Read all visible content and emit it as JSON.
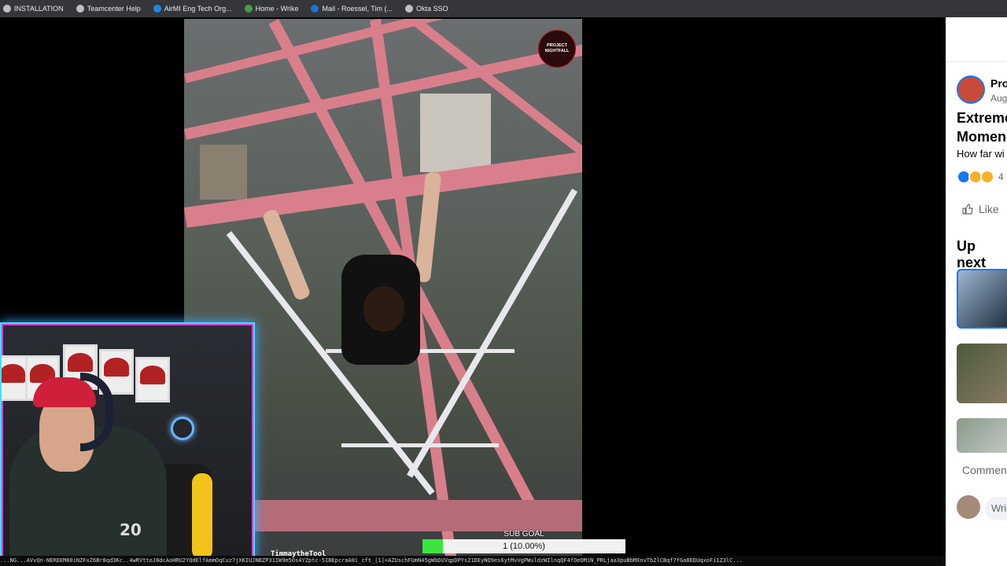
{
  "bookmarks": [
    {
      "label": "INSTALLATION",
      "icon": "chrome-icon",
      "color": "#bdc1c6"
    },
    {
      "label": "Teamcenter Help",
      "icon": "globe-icon",
      "color": "#bdc1c6"
    },
    {
      "label": "AirMI Eng Tech Org...",
      "icon": "sharepoint-icon",
      "color": "#1e88e5"
    },
    {
      "label": "Home - Wrike",
      "icon": "wrike-icon",
      "color": "#43a047"
    },
    {
      "label": "Mail - Roessel, Tim (...",
      "icon": "outlook-icon",
      "color": "#1976d2"
    },
    {
      "label": "Okta SSO",
      "icon": "globe-icon",
      "color": "#bdc1c6"
    }
  ],
  "video": {
    "watermark": "PROJECT NIGHTFALL"
  },
  "overlay": {
    "subgoal_label": "SUB GOAL",
    "subgoal_value": "1 (10.00%)",
    "subgoal_progress": 0.1,
    "streamer_name": "TimmaytheTool",
    "ticker_text": "...NG...AVvQn-NERDEM80iNZFxZ6Br8qd3Kc..4wRVttoJ8dcAoHRU2YQdElfAmmOqCuz7jXKIUJNBZP31IW9m5Os4YZptc-5IBEpcraA0i_cft_[1]=AZUschFUmN45gWbDUVqpDPYs21DEyNQ9es6ytMvVgPWuldzWIlnqQF4fOeOMiN_PRLjaa3puBbMXnvTbZlCBqf7fGa8EDUqxoFi1Z3lC..."
  },
  "webcam": {
    "hoodie_number": "20"
  },
  "side_panel": {
    "page_name": "Pro",
    "date": "Aug",
    "title_line1": "Extreme",
    "title_line2": "Momen",
    "description": "How far wi",
    "reaction_count": "4",
    "like_label": "Like",
    "up_next_label": "Up next",
    "comment_label": "Commen",
    "write_placeholder": "Wri"
  },
  "colors": {
    "accent_blue": "#1877f2",
    "webcam_border": "#3fe0ff",
    "progress_green": "#3ee43e"
  }
}
